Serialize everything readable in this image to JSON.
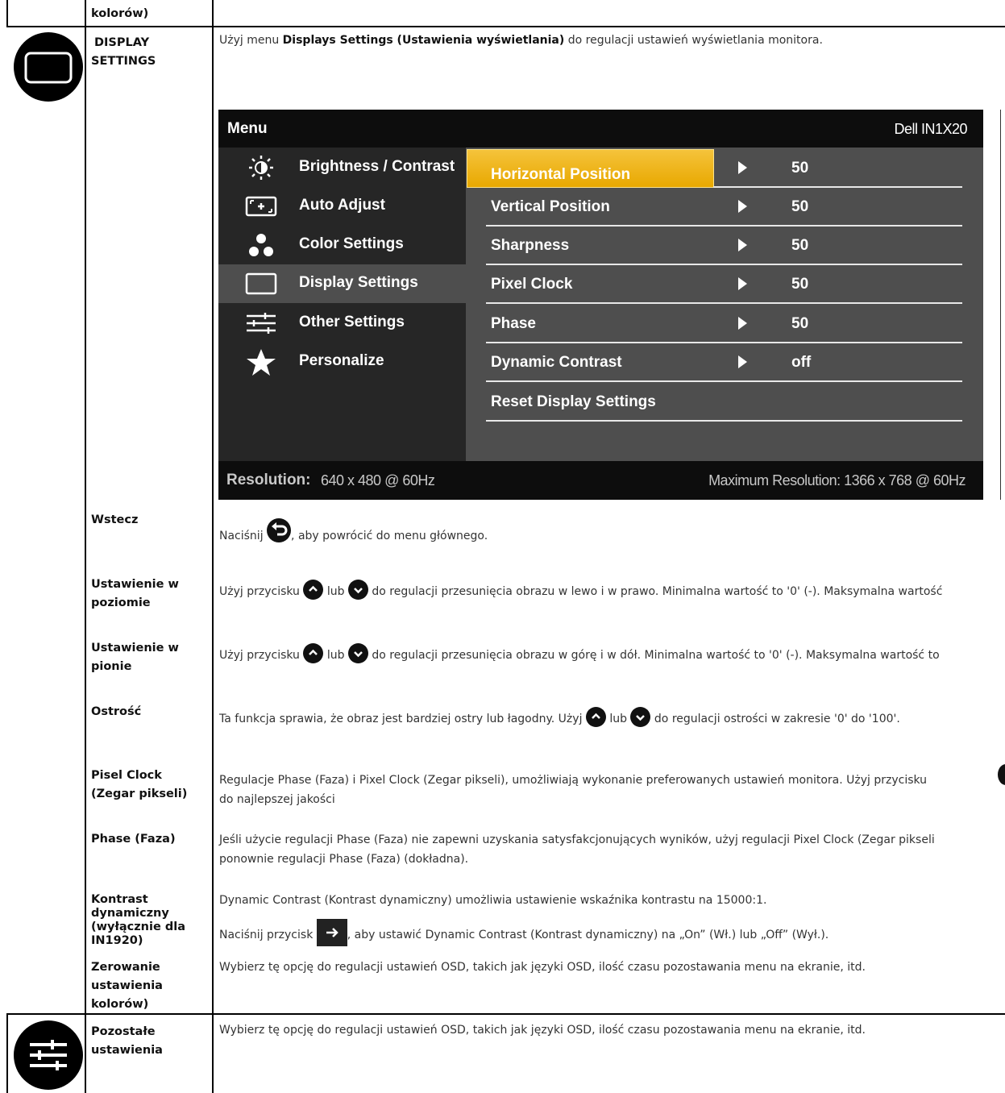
{
  "top_row": {
    "label": "kolorów)"
  },
  "display": {
    "section_title": " DISPLAY SETTINGS",
    "section_title_l1": "DISPLAY",
    "section_title_l2": "SETTINGS",
    "icon": "display-settings-icon",
    "intro_pre": "Użyj menu ",
    "intro_bold": "Displays Settings (Ustawienia wyświetlania)",
    "intro_post": " do regulacji ustawień wyświetlania monitora."
  },
  "osd": {
    "menu_title": "Menu",
    "model": "Dell IN1X20",
    "menu_items": [
      {
        "label": "Brightness / Contrast",
        "icon": "brightness-icon"
      },
      {
        "label": "Auto Adjust",
        "icon": "auto-adjust-icon"
      },
      {
        "label": "Color Settings",
        "icon": "color-settings-icon"
      },
      {
        "label": "Display Settings",
        "icon": "display-icon"
      },
      {
        "label": "Other Settings",
        "icon": "sliders-icon"
      },
      {
        "label": "Personalize",
        "icon": "star-icon"
      }
    ],
    "settings": [
      {
        "name": "Horizontal Position",
        "value": "50"
      },
      {
        "name": "Vertical Position",
        "value": "50"
      },
      {
        "name": "Sharpness",
        "value": "50"
      },
      {
        "name": "Pixel Clock",
        "value": "50"
      },
      {
        "name": "Phase",
        "value": "50"
      },
      {
        "name": "Dynamic Contrast",
        "value": "off"
      },
      {
        "name": "Reset Display Settings",
        "value": ""
      }
    ],
    "resolution_label": "Resolution:",
    "resolution_value": "640 x 480 @ 60Hz",
    "max_resolution": "Maximum Resolution: 1366 x 768 @ 60Hz",
    "highlight_color": "#e8a800"
  },
  "rows": {
    "wstecz": {
      "label": "Wstecz",
      "pre": "Naciśnij ",
      "post": ", aby powrócić do menu głównego."
    },
    "poziom": {
      "label": "Ustawienie w poziomie",
      "pre": "Użyj przycisku ",
      "mid": " lub ",
      "post": " do regulacji przesunięcia obrazu w lewo i w prawo. Minimalna wartość to '0' (-). Maksymalna wartość"
    },
    "pion": {
      "label": "Ustawienie w pionie",
      "pre": "Użyj przycisku ",
      "mid": " lub ",
      "post": " do regulacji przesunięcia obrazu w górę i w dół. Minimalna wartość to '0' (-). Maksymalna wartość to"
    },
    "ostrosc": {
      "label": "Ostrość",
      "pre": "Ta funkcja sprawia, że obraz jest bardziej ostry lub łagodny. Użyj ",
      "mid": " lub ",
      "post": " do regulacji ostrości w zakresie '0' do '100'."
    },
    "pixel": {
      "label": "Pisel Clock (Zegar pikseli)",
      "line1": "Regulacje Phase (Faza) i Pixel Clock (Zegar pikseli), umożliwiają wykonanie preferowanych ustawień monitora. Użyj przycisku",
      "line2": "do najlepszej jakości"
    },
    "phase": {
      "label": "Phase (Faza)",
      "line1": "Jeśli użycie regulacji Phase (Faza) nie zapewni uzyskania satysfakcjonujących wyników, użyj regulacji Pixel Clock (Zegar pikseli",
      "line2": "ponownie regulacji Phase (Faza) (dokładna)."
    },
    "kontrast": {
      "label": "Kontrast dynamiczny (wyłącznie dla IN1920)",
      "line1": "Dynamic Contrast (Kontrast dynamiczny) umożliwia ustawienie wskaźnika kontrastu na 15000:1.",
      "line2_pre": "Naciśnij przycisk ",
      "line2_post": ", aby ustawić Dynamic Contrast (Kontrast dynamiczny) na „On” (Wł.) lub „Off” (Wył.)."
    },
    "zerowanie": {
      "label": "Zerowanie ustawienia kolorów)",
      "text": "Wybierz tę opcję do regulacji ustawień OSD, takich jak języki OSD, ilość czasu pozostawania menu na ekranie, itd."
    }
  },
  "other": {
    "label": "Pozostałe ustawienia",
    "icon": "other-settings-icon",
    "text": "Wybierz tę opcję do regulacji ustawień OSD, takich jak języki OSD, ilość czasu pozostawania menu na ekranie, itd."
  }
}
